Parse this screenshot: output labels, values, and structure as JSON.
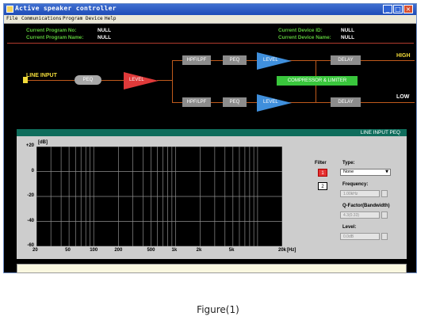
{
  "window": {
    "title": "Active speaker controller",
    "buttons": [
      "_",
      "□",
      "×"
    ]
  },
  "menu": [
    "File",
    "Communications",
    "Program",
    "Device",
    "Help"
  ],
  "info": {
    "program_no_label": "Current Program No:",
    "program_no_value": "NULL",
    "program_name_label": "Current Program Name:",
    "program_name_value": "NULL",
    "device_id_label": "Current Device ID:",
    "device_id_value": "NULL",
    "device_name_label": "Current Device Name:",
    "device_name_value": "NULL"
  },
  "diagram": {
    "input_label": "LINE INPUT",
    "peq_main": "PEQ",
    "level_main": "LEVEL",
    "high_label": "HIGH",
    "low_label": "LOW",
    "hpf_high": "HPF/LPF",
    "peq_high": "PEQ",
    "level_high": "LEVEL",
    "delay_high": "DELAY",
    "compressor": "COMPRESSOR & LIMITER",
    "hpf_low": "HPF/LPF",
    "peq_low": "PEQ",
    "level_low": "LEVEL",
    "delay_low": "DELAY"
  },
  "panel": {
    "title": "LINE INPUT PEQ",
    "filter_label": "Filter",
    "filter_1": "1",
    "filter_2": "2",
    "type_label": "Type:",
    "type_value": "None",
    "frequency_label": "Frequency:",
    "frequency_value": "1.00kHz",
    "q_label": "Q-Factor(Bandwidth)",
    "q_value": "4.3(0.33)",
    "level_label": "Level:",
    "level_value": "0.0dB"
  },
  "chart_data": {
    "type": "line",
    "ylabel": "[dB]",
    "ylim": [
      -60,
      20
    ],
    "y_ticks": [
      "+20",
      "0",
      "-20",
      "-40",
      "-60"
    ],
    "y_tick_values": [
      20,
      0,
      -20,
      -40,
      -60
    ],
    "xlabel": "[Hz]",
    "x_scale": "log",
    "xlim": [
      20,
      20000
    ],
    "x_ticks": [
      "20",
      "50",
      "100",
      "200",
      "500",
      "1k",
      "2k",
      "5k",
      "20k"
    ],
    "x_tick_values": [
      20,
      50,
      100,
      200,
      500,
      1000,
      2000,
      5000,
      20000
    ],
    "grid": true,
    "series": []
  },
  "caption": "Figure(1)"
}
